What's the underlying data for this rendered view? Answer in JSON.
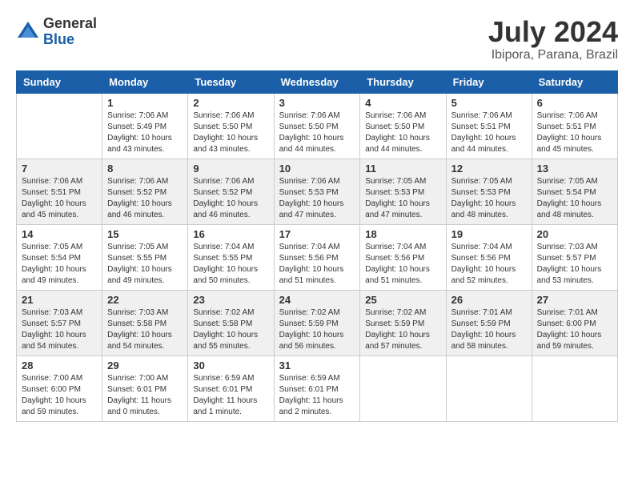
{
  "header": {
    "logo_general": "General",
    "logo_blue": "Blue",
    "month_year": "July 2024",
    "location": "Ibipora, Parana, Brazil"
  },
  "days_of_week": [
    "Sunday",
    "Monday",
    "Tuesday",
    "Wednesday",
    "Thursday",
    "Friday",
    "Saturday"
  ],
  "weeks": [
    [
      {
        "day": "",
        "sunrise": "",
        "sunset": "",
        "daylight": ""
      },
      {
        "day": "1",
        "sunrise": "Sunrise: 7:06 AM",
        "sunset": "Sunset: 5:49 PM",
        "daylight": "Daylight: 10 hours and 43 minutes."
      },
      {
        "day": "2",
        "sunrise": "Sunrise: 7:06 AM",
        "sunset": "Sunset: 5:50 PM",
        "daylight": "Daylight: 10 hours and 43 minutes."
      },
      {
        "day": "3",
        "sunrise": "Sunrise: 7:06 AM",
        "sunset": "Sunset: 5:50 PM",
        "daylight": "Daylight: 10 hours and 44 minutes."
      },
      {
        "day": "4",
        "sunrise": "Sunrise: 7:06 AM",
        "sunset": "Sunset: 5:50 PM",
        "daylight": "Daylight: 10 hours and 44 minutes."
      },
      {
        "day": "5",
        "sunrise": "Sunrise: 7:06 AM",
        "sunset": "Sunset: 5:51 PM",
        "daylight": "Daylight: 10 hours and 44 minutes."
      },
      {
        "day": "6",
        "sunrise": "Sunrise: 7:06 AM",
        "sunset": "Sunset: 5:51 PM",
        "daylight": "Daylight: 10 hours and 45 minutes."
      }
    ],
    [
      {
        "day": "7",
        "sunrise": "Sunrise: 7:06 AM",
        "sunset": "Sunset: 5:51 PM",
        "daylight": "Daylight: 10 hours and 45 minutes."
      },
      {
        "day": "8",
        "sunrise": "Sunrise: 7:06 AM",
        "sunset": "Sunset: 5:52 PM",
        "daylight": "Daylight: 10 hours and 46 minutes."
      },
      {
        "day": "9",
        "sunrise": "Sunrise: 7:06 AM",
        "sunset": "Sunset: 5:52 PM",
        "daylight": "Daylight: 10 hours and 46 minutes."
      },
      {
        "day": "10",
        "sunrise": "Sunrise: 7:06 AM",
        "sunset": "Sunset: 5:53 PM",
        "daylight": "Daylight: 10 hours and 47 minutes."
      },
      {
        "day": "11",
        "sunrise": "Sunrise: 7:05 AM",
        "sunset": "Sunset: 5:53 PM",
        "daylight": "Daylight: 10 hours and 47 minutes."
      },
      {
        "day": "12",
        "sunrise": "Sunrise: 7:05 AM",
        "sunset": "Sunset: 5:53 PM",
        "daylight": "Daylight: 10 hours and 48 minutes."
      },
      {
        "day": "13",
        "sunrise": "Sunrise: 7:05 AM",
        "sunset": "Sunset: 5:54 PM",
        "daylight": "Daylight: 10 hours and 48 minutes."
      }
    ],
    [
      {
        "day": "14",
        "sunrise": "Sunrise: 7:05 AM",
        "sunset": "Sunset: 5:54 PM",
        "daylight": "Daylight: 10 hours and 49 minutes."
      },
      {
        "day": "15",
        "sunrise": "Sunrise: 7:05 AM",
        "sunset": "Sunset: 5:55 PM",
        "daylight": "Daylight: 10 hours and 49 minutes."
      },
      {
        "day": "16",
        "sunrise": "Sunrise: 7:04 AM",
        "sunset": "Sunset: 5:55 PM",
        "daylight": "Daylight: 10 hours and 50 minutes."
      },
      {
        "day": "17",
        "sunrise": "Sunrise: 7:04 AM",
        "sunset": "Sunset: 5:56 PM",
        "daylight": "Daylight: 10 hours and 51 minutes."
      },
      {
        "day": "18",
        "sunrise": "Sunrise: 7:04 AM",
        "sunset": "Sunset: 5:56 PM",
        "daylight": "Daylight: 10 hours and 51 minutes."
      },
      {
        "day": "19",
        "sunrise": "Sunrise: 7:04 AM",
        "sunset": "Sunset: 5:56 PM",
        "daylight": "Daylight: 10 hours and 52 minutes."
      },
      {
        "day": "20",
        "sunrise": "Sunrise: 7:03 AM",
        "sunset": "Sunset: 5:57 PM",
        "daylight": "Daylight: 10 hours and 53 minutes."
      }
    ],
    [
      {
        "day": "21",
        "sunrise": "Sunrise: 7:03 AM",
        "sunset": "Sunset: 5:57 PM",
        "daylight": "Daylight: 10 hours and 54 minutes."
      },
      {
        "day": "22",
        "sunrise": "Sunrise: 7:03 AM",
        "sunset": "Sunset: 5:58 PM",
        "daylight": "Daylight: 10 hours and 54 minutes."
      },
      {
        "day": "23",
        "sunrise": "Sunrise: 7:02 AM",
        "sunset": "Sunset: 5:58 PM",
        "daylight": "Daylight: 10 hours and 55 minutes."
      },
      {
        "day": "24",
        "sunrise": "Sunrise: 7:02 AM",
        "sunset": "Sunset: 5:59 PM",
        "daylight": "Daylight: 10 hours and 56 minutes."
      },
      {
        "day": "25",
        "sunrise": "Sunrise: 7:02 AM",
        "sunset": "Sunset: 5:59 PM",
        "daylight": "Daylight: 10 hours and 57 minutes."
      },
      {
        "day": "26",
        "sunrise": "Sunrise: 7:01 AM",
        "sunset": "Sunset: 5:59 PM",
        "daylight": "Daylight: 10 hours and 58 minutes."
      },
      {
        "day": "27",
        "sunrise": "Sunrise: 7:01 AM",
        "sunset": "Sunset: 6:00 PM",
        "daylight": "Daylight: 10 hours and 59 minutes."
      }
    ],
    [
      {
        "day": "28",
        "sunrise": "Sunrise: 7:00 AM",
        "sunset": "Sunset: 6:00 PM",
        "daylight": "Daylight: 10 hours and 59 minutes."
      },
      {
        "day": "29",
        "sunrise": "Sunrise: 7:00 AM",
        "sunset": "Sunset: 6:01 PM",
        "daylight": "Daylight: 11 hours and 0 minutes."
      },
      {
        "day": "30",
        "sunrise": "Sunrise: 6:59 AM",
        "sunset": "Sunset: 6:01 PM",
        "daylight": "Daylight: 11 hours and 1 minute."
      },
      {
        "day": "31",
        "sunrise": "Sunrise: 6:59 AM",
        "sunset": "Sunset: 6:01 PM",
        "daylight": "Daylight: 11 hours and 2 minutes."
      },
      {
        "day": "",
        "sunrise": "",
        "sunset": "",
        "daylight": ""
      },
      {
        "day": "",
        "sunrise": "",
        "sunset": "",
        "daylight": ""
      },
      {
        "day": "",
        "sunrise": "",
        "sunset": "",
        "daylight": ""
      }
    ]
  ]
}
